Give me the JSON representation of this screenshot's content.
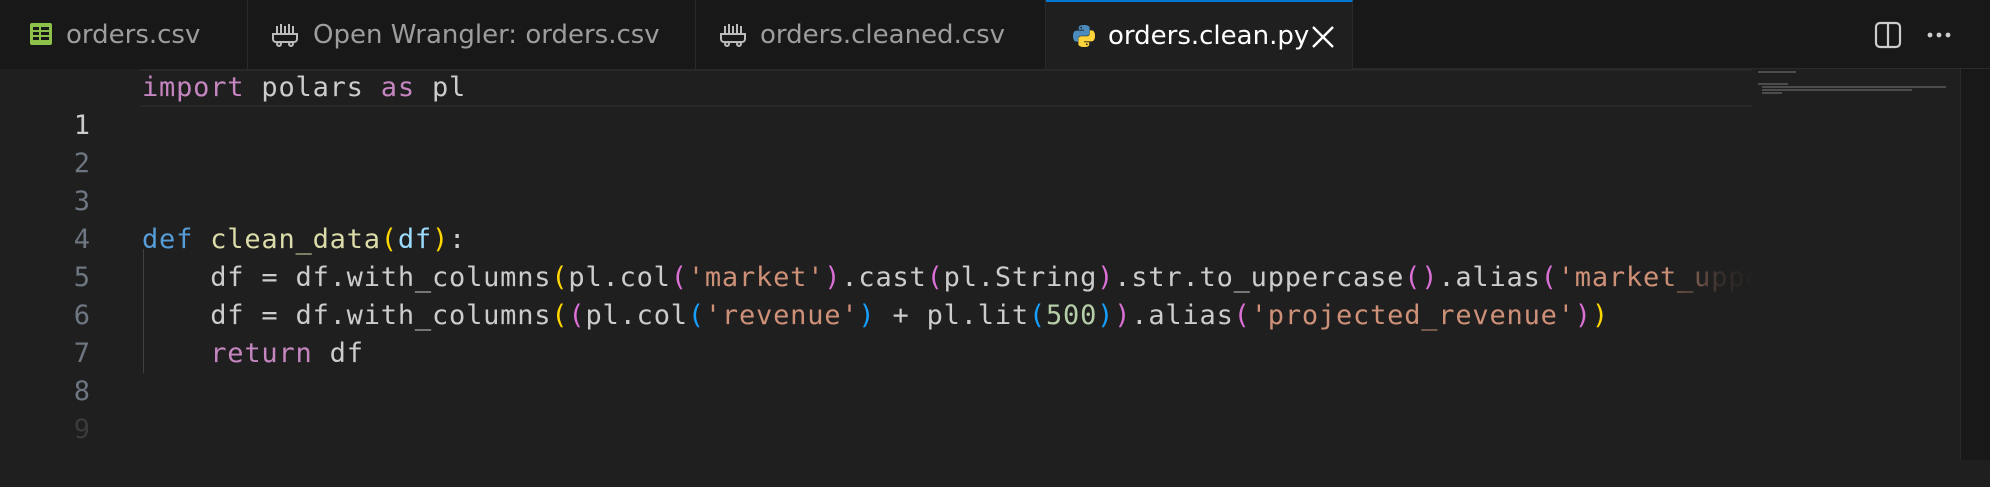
{
  "tabs": [
    {
      "label": "orders.csv",
      "icon": "spreadsheet-icon",
      "active": false
    },
    {
      "label": "Open Wrangler: orders.csv",
      "icon": "data-wrangler-icon",
      "active": false
    },
    {
      "label": "orders.cleaned.csv",
      "icon": "data-wrangler-icon",
      "active": false
    },
    {
      "label": "orders.clean.py",
      "icon": "python-icon",
      "active": true
    }
  ],
  "actions": [
    {
      "name": "split-editor",
      "icon": "split-editor-icon"
    },
    {
      "name": "more-actions",
      "icon": "ellipsis-icon"
    }
  ],
  "editor": {
    "current_line": 1,
    "line_numbers": [
      "1",
      "2",
      "3",
      "4",
      "5",
      "6",
      "7",
      "8",
      "9"
    ],
    "code": {
      "line1": {
        "import": "import",
        "module": " polars ",
        "as": "as",
        "alias": " pl"
      },
      "line5": {
        "def": "def",
        "sp": " ",
        "fname": "clean_data",
        "open": "(",
        "param": "df",
        "close": ")",
        "colon": ":"
      },
      "line6": {
        "indent": "    ",
        "a": "df = df.with_columns",
        "p1": "(",
        "b": "pl.col",
        "p2": "(",
        "s1": "'market'",
        "p2c": ")",
        "c": ".cast",
        "p3": "(",
        "d": "pl.String",
        "p3c": ")",
        "e": ".str.to_uppercase",
        "p4": "()",
        "f": ".alias",
        "p5": "(",
        "s2": "'market_upper'",
        "p5c": ")",
        "p1c": ")"
      },
      "line7": {
        "indent": "    ",
        "a": "df = df.with_columns",
        "p1": "(",
        "p2": "(",
        "b": "pl.col",
        "p3": "(",
        "s1": "'revenue'",
        "p3c": ")",
        "c": " + pl.lit",
        "p4": "(",
        "n": "500",
        "p4c": ")",
        "p2c": ")",
        "d": ".alias",
        "p5": "(",
        "s2": "'projected_revenue'",
        "p5c": ")",
        "p1c": ")"
      },
      "line8": {
        "indent": "    ",
        "ret": "return",
        "var": " df"
      }
    }
  },
  "colors": {
    "accent": "#0078d4",
    "keyword_control": "#c586c0",
    "keyword_def": "#569cd6",
    "function": "#dcdcaa",
    "string": "#ce9178",
    "number": "#b5cea8"
  }
}
